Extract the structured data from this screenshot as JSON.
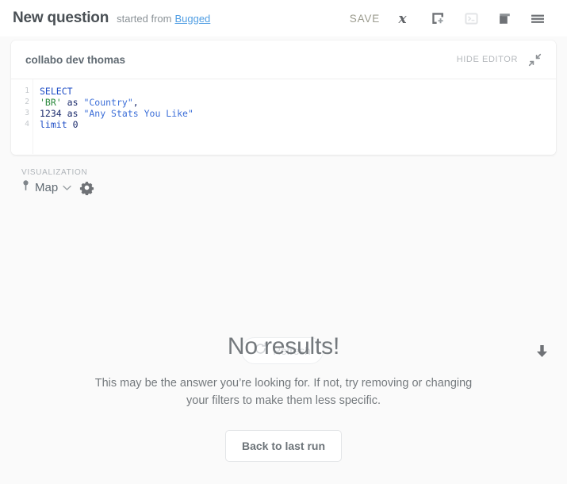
{
  "header": {
    "title": "New question",
    "started_from_label": "started from",
    "source_link": "Bugged",
    "save_label": "SAVE",
    "icons": [
      {
        "name": "variables-icon",
        "title": "Variables"
      },
      {
        "name": "add-to-dashboard-icon",
        "title": "Add to dashboard"
      },
      {
        "name": "console-icon",
        "title": "Console"
      },
      {
        "name": "duplicate-icon",
        "title": "Duplicate"
      },
      {
        "name": "hamburger-menu-icon",
        "title": "Menu"
      }
    ]
  },
  "editor": {
    "database": "collabo dev thomas",
    "hide_editor_label": "HIDE EDITOR",
    "contract_icon": "contract-arrows-icon",
    "line_numbers": [
      "1",
      "2",
      "3",
      "4"
    ],
    "sql": {
      "line1": {
        "keyword": "SELECT"
      },
      "line2": {
        "string": "'BR'",
        "op": "as",
        "alias": "\"Country\"",
        "punct": ","
      },
      "line3": {
        "number": "1234",
        "op": "as",
        "alias": "\"Any Stats You Like\""
      },
      "line4": {
        "keyword": "limit",
        "number": "0"
      }
    }
  },
  "visualization": {
    "section_label": "VISUALIZATION",
    "type": "Map",
    "type_icon": "map-pin-icon",
    "chevron_icon": "chevron-down-icon",
    "settings_icon": "gear-icon",
    "refresh_label": "Refresh",
    "refresh_icon": "refresh-circle-arrow-icon",
    "download_icon": "download-arrow-icon"
  },
  "empty_state": {
    "title": "No results!",
    "description": "This may be the answer you’re looking for. If not, try removing or changing your filters to make them less specific.",
    "button_label": "Back to last run"
  },
  "colors": {
    "accent_blue": "#509ee3",
    "text_dark": "#4a5055",
    "text_muted": "#8a9196",
    "page_bg": "#fafafa",
    "card_bg": "#ffffff",
    "sql_keyword": "#1f4ec6",
    "sql_string": "#2b8a3e",
    "sql_alias": "#3b6ed8"
  }
}
